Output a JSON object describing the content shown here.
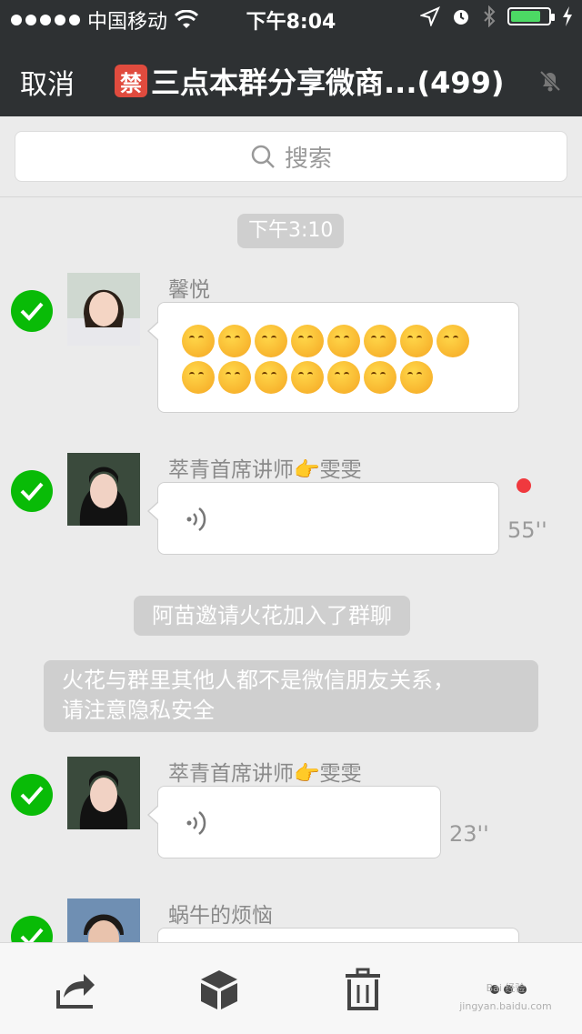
{
  "status_bar": {
    "carrier": "中国移动",
    "time": "下午8:04",
    "battery_level": 0.8,
    "icons": [
      "signal-dots-icon",
      "wifi-icon",
      "location-arrow-icon",
      "alarm-icon",
      "bluetooth-icon",
      "battery-icon",
      "charging-bolt-icon"
    ]
  },
  "nav": {
    "cancel_label": "取消",
    "ban_badge": "禁",
    "title": "三点本群分享微商...(499)",
    "mute_icon": "bell-muted-icon"
  },
  "search": {
    "placeholder": "搜索"
  },
  "chat": {
    "timestamp": "下午3:10",
    "messages": [
      {
        "sender": "馨悦",
        "type": "emoji",
        "selected": true,
        "emoji_rows": [
          8,
          7
        ],
        "emoji_name": "hugging-face-emoji"
      },
      {
        "sender": "萃青首席讲师👉雯雯",
        "type": "voice",
        "duration": "55''",
        "unread": true,
        "selected": true
      },
      {
        "type": "system",
        "text": "阿苗邀请火花加入了群聊"
      },
      {
        "type": "system",
        "text_line1": "火花与群里其他人都不是微信朋友关系，",
        "text_line2": "请注意隐私安全"
      },
      {
        "sender": "萃青首席讲师👉雯雯",
        "type": "voice",
        "duration": "23''",
        "selected": true
      },
      {
        "sender": "蜗牛的烦恼",
        "type": "text",
        "selected": true
      }
    ]
  },
  "toolbar": {
    "items": [
      "share-icon",
      "favorite-box-icon",
      "delete-trash-icon",
      "more-icon"
    ]
  },
  "watermark": "Bai 经验 jingyan.baidu.com",
  "colors": {
    "nav_bg": "#2e3133",
    "check_green": "#09bb07",
    "unread_red": "#f0393e",
    "chat_bg": "#ebebeb"
  }
}
